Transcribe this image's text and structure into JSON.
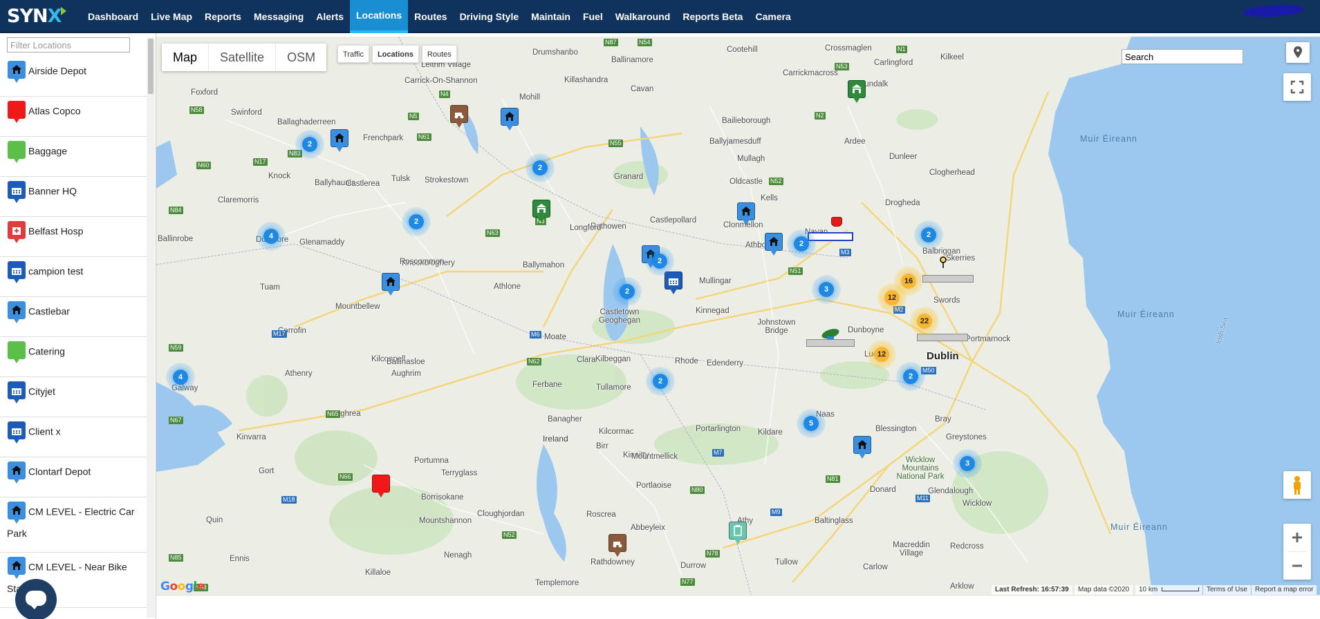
{
  "nav": {
    "logo_text": "SYN",
    "logo_x": "X",
    "items": [
      {
        "label": "Dashboard"
      },
      {
        "label": "Live Map"
      },
      {
        "label": "Reports"
      },
      {
        "label": "Messaging"
      },
      {
        "label": "Alerts"
      },
      {
        "label": "Locations"
      },
      {
        "label": "Routes"
      },
      {
        "label": "Driving Style"
      },
      {
        "label": "Maintain"
      },
      {
        "label": "Fuel"
      },
      {
        "label": "Walkaround"
      },
      {
        "label": "Reports Beta"
      },
      {
        "label": "Camera"
      }
    ],
    "active": "Locations"
  },
  "sidebar": {
    "filter_placeholder": "Filter Locations",
    "locations": [
      {
        "label": "Airside Depot",
        "icon": "house-icon",
        "color": "#3b8fe0"
      },
      {
        "label": "Atlas Copco",
        "icon": "blank-icon",
        "color": "#f01818"
      },
      {
        "label": "Baggage",
        "icon": "blank-icon",
        "color": "#5cbf4a"
      },
      {
        "label": "Banner HQ",
        "icon": "factory-icon",
        "color": "#1d5bb8"
      },
      {
        "label": "Belfast Hosp",
        "icon": "hospital-icon",
        "color": "#e23b3b"
      },
      {
        "label": "campion test",
        "icon": "factory-icon",
        "color": "#1d5bb8"
      },
      {
        "label": "Castlebar",
        "icon": "house-icon",
        "color": "#3b8fe0"
      },
      {
        "label": "Catering",
        "icon": "blank-icon",
        "color": "#5cbf4a"
      },
      {
        "label": "Cityjet",
        "icon": "factory-icon",
        "color": "#1d5bb8"
      },
      {
        "label": "Client x",
        "icon": "factory-icon",
        "color": "#1d5bb8"
      },
      {
        "label": "Clontarf Depot",
        "icon": "house-icon",
        "color": "#3b8fe0"
      },
      {
        "label": "CM LEVEL - Electric Car Park",
        "icon": "house-icon",
        "color": "#3b8fe0"
      },
      {
        "label": "CM LEVEL - Near Bike Stand",
        "icon": "house-icon",
        "color": "#3b8fe0"
      }
    ]
  },
  "map": {
    "types": [
      "Map",
      "Satellite",
      "OSM"
    ],
    "active_type": "Map",
    "layers": [
      "Traffic",
      "Locations",
      "Routes"
    ],
    "active_layer": "Locations",
    "search_value": "Search",
    "google": "Google",
    "last_refresh_label": "Last Refresh:",
    "last_refresh_time": "16:57:39",
    "map_data": "Map data ©2020",
    "scale": "10 km",
    "terms": "Terms of Use",
    "report": "Report a map error",
    "towns": [
      {
        "name": "Drumshanbo"
      },
      {
        "name": "Ballinamore"
      },
      {
        "name": "Cootehill"
      },
      {
        "name": "Crossmaglen"
      },
      {
        "name": "Carlingford"
      },
      {
        "name": "Kilkeel"
      },
      {
        "name": "Foxford"
      },
      {
        "name": "Swinford"
      },
      {
        "name": "Leitrim Village"
      },
      {
        "name": "Killashandra"
      },
      {
        "name": "Cavan"
      },
      {
        "name": "Carrickmacross"
      },
      {
        "name": "Dundalk"
      },
      {
        "name": "Carrick-On-Shannon"
      },
      {
        "name": "Mohill"
      },
      {
        "name": "Bailieborough"
      },
      {
        "name": "Ballaghaderreen"
      },
      {
        "name": "Frenchpark"
      },
      {
        "name": "Ballyjamesduff"
      },
      {
        "name": "Ardee"
      },
      {
        "name": "Knock"
      },
      {
        "name": "Ballyhaunis"
      },
      {
        "name": "Tulsk"
      },
      {
        "name": "Strokestown"
      },
      {
        "name": "Mullagh"
      },
      {
        "name": "Dunleer"
      },
      {
        "name": "Castlerea"
      },
      {
        "name": "Claremorris"
      },
      {
        "name": "Granard"
      },
      {
        "name": "Oldcastle"
      },
      {
        "name": "Clogherhead"
      },
      {
        "name": "Kells"
      },
      {
        "name": "Drogheda"
      },
      {
        "name": "Rathowen"
      },
      {
        "name": "Castlepollard"
      },
      {
        "name": "Clonmellon"
      },
      {
        "name": "Ballinrobe"
      },
      {
        "name": "Dunmore"
      },
      {
        "name": "Glenamaddy"
      },
      {
        "name": "Knockcroghery"
      },
      {
        "name": "Athboy"
      },
      {
        "name": "Balbriggan"
      },
      {
        "name": "Skerries"
      },
      {
        "name": "Ballymahon"
      },
      {
        "name": "Tuam"
      },
      {
        "name": "Mountbellew"
      },
      {
        "name": "Castletown Geoghegan"
      },
      {
        "name": "Kinnegad"
      },
      {
        "name": "Johnstown Bridge"
      },
      {
        "name": "Corrofin"
      },
      {
        "name": "Moate"
      },
      {
        "name": "Portmarnock"
      },
      {
        "name": "Kilbeggan"
      },
      {
        "name": "Rhode"
      },
      {
        "name": "Lucan"
      },
      {
        "name": "Dublin"
      },
      {
        "name": "Kilconnell"
      },
      {
        "name": "Ballinasloe"
      },
      {
        "name": "Clara"
      },
      {
        "name": "Edenderry"
      },
      {
        "name": "Athenry"
      },
      {
        "name": "Aughrim"
      },
      {
        "name": "Ferbane"
      },
      {
        "name": "Tullamore"
      },
      {
        "name": "Galway"
      },
      {
        "name": "Naas"
      },
      {
        "name": "Bray"
      },
      {
        "name": "Loughrea"
      },
      {
        "name": "Banagher"
      },
      {
        "name": "Kilcormac"
      },
      {
        "name": "Portarlington"
      },
      {
        "name": "Kildare"
      },
      {
        "name": "Blessington"
      },
      {
        "name": "Greystones"
      },
      {
        "name": "Kinvarra"
      },
      {
        "name": "Ireland"
      },
      {
        "name": "Birr"
      },
      {
        "name": "Kinnitty"
      },
      {
        "name": "Mountmellick"
      },
      {
        "name": "Wicklow Mountains National Park"
      },
      {
        "name": "Gort"
      },
      {
        "name": "Portumna"
      },
      {
        "name": "Terryglass"
      },
      {
        "name": "Glendalough"
      },
      {
        "name": "Portlaoise"
      },
      {
        "name": "Donard"
      },
      {
        "name": "Borrisokane"
      },
      {
        "name": "Wicklow"
      },
      {
        "name": "Mountshannon"
      },
      {
        "name": "Cloughjordan"
      },
      {
        "name": "Roscrea"
      },
      {
        "name": "Athy"
      },
      {
        "name": "Baltinglass"
      },
      {
        "name": "Abbeyleix"
      },
      {
        "name": "Macreddin Village"
      },
      {
        "name": "Redcross"
      },
      {
        "name": "Ennis"
      },
      {
        "name": "Nenagh"
      },
      {
        "name": "Rathdowney"
      },
      {
        "name": "Durrow"
      },
      {
        "name": "Tullow"
      },
      {
        "name": "Carlow"
      },
      {
        "name": "Killaloe"
      },
      {
        "name": "Templemore"
      },
      {
        "name": "Arklow"
      },
      {
        "name": "Quin"
      },
      {
        "name": "Navan"
      },
      {
        "name": "Mullingar"
      },
      {
        "name": "Athlone"
      },
      {
        "name": "Roscommon"
      },
      {
        "name": "Longford"
      },
      {
        "name": "Swords"
      },
      {
        "name": "Dunboyne"
      },
      {
        "name": "Irish Sea"
      }
    ],
    "seas": [
      {
        "name": "Muir Éireann"
      },
      {
        "name": "Muir Éireann"
      },
      {
        "name": "Muir Éireann"
      }
    ],
    "roads": [
      {
        "name": "N87"
      },
      {
        "name": "N54"
      },
      {
        "name": "N1"
      },
      {
        "name": "N53"
      },
      {
        "name": "N4"
      },
      {
        "name": "N5"
      },
      {
        "name": "N58"
      },
      {
        "name": "N61"
      },
      {
        "name": "N55"
      },
      {
        "name": "N2"
      },
      {
        "name": "N60"
      },
      {
        "name": "N17"
      },
      {
        "name": "N83"
      },
      {
        "name": "N52"
      },
      {
        "name": "N51"
      },
      {
        "name": "N84"
      },
      {
        "name": "N63"
      },
      {
        "name": "N6"
      },
      {
        "name": "M6"
      },
      {
        "name": "M17"
      },
      {
        "name": "N59"
      },
      {
        "name": "N62"
      },
      {
        "name": "N65"
      },
      {
        "name": "N66"
      },
      {
        "name": "M18"
      },
      {
        "name": "M7"
      },
      {
        "name": "M9"
      },
      {
        "name": "N80"
      },
      {
        "name": "N81"
      },
      {
        "name": "M11"
      },
      {
        "name": "M3"
      },
      {
        "name": "M2"
      },
      {
        "name": "M50"
      },
      {
        "name": "N67"
      },
      {
        "name": "N85"
      },
      {
        "name": "N78"
      },
      {
        "name": "N77"
      },
      {
        "name": "N52"
      },
      {
        "name": "N68"
      }
    ],
    "clusters": [
      {
        "count": "2"
      },
      {
        "count": "2"
      },
      {
        "count": "2"
      },
      {
        "count": "4"
      },
      {
        "count": "2"
      },
      {
        "count": "2"
      },
      {
        "count": "2"
      },
      {
        "count": "3"
      },
      {
        "count": "2"
      },
      {
        "count": "4"
      },
      {
        "count": "2"
      },
      {
        "count": "5"
      },
      {
        "count": "2"
      },
      {
        "count": "3"
      },
      {
        "count": "16"
      },
      {
        "count": "12"
      },
      {
        "count": "22"
      },
      {
        "count": "12"
      }
    ]
  }
}
